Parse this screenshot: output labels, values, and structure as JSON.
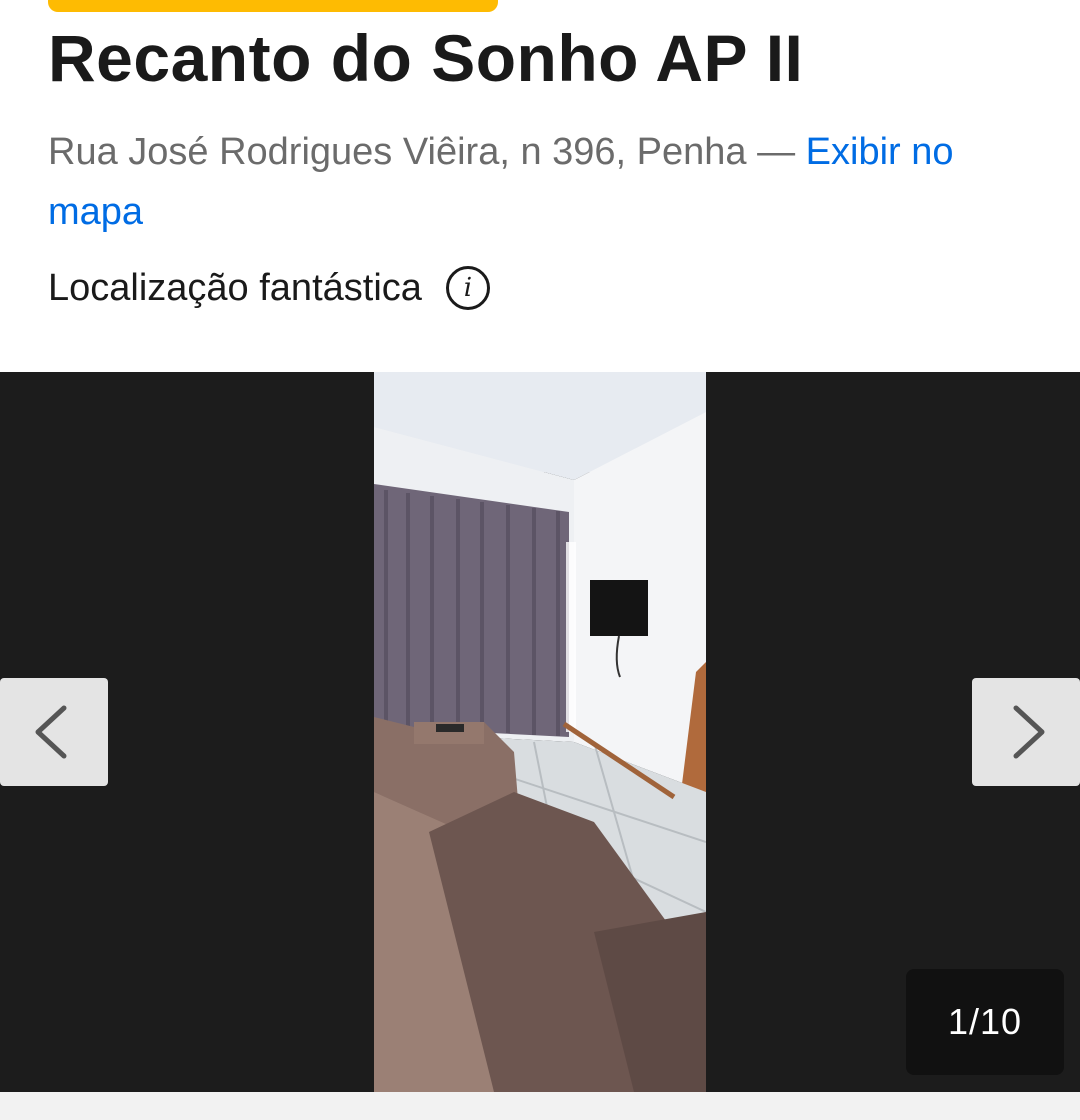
{
  "property": {
    "name": "Recanto do Sonho AP II",
    "address": "Rua José Rodrigues Viêira, n 396, Penha",
    "separator": " — ",
    "map_link": "Exibir no mapa",
    "location_rating": "Localização fantástica"
  },
  "gallery": {
    "counter": "1/10",
    "current": 1,
    "total": 10,
    "photo_subject": "living room with sofa, curtains and wall TV"
  },
  "icons": {
    "info": "info-icon",
    "prev": "chevron-left-icon",
    "next": "chevron-right-icon"
  },
  "colors": {
    "badge": "#febb02",
    "link": "#006ce4",
    "gallery_bg": "#1c1c1c"
  }
}
